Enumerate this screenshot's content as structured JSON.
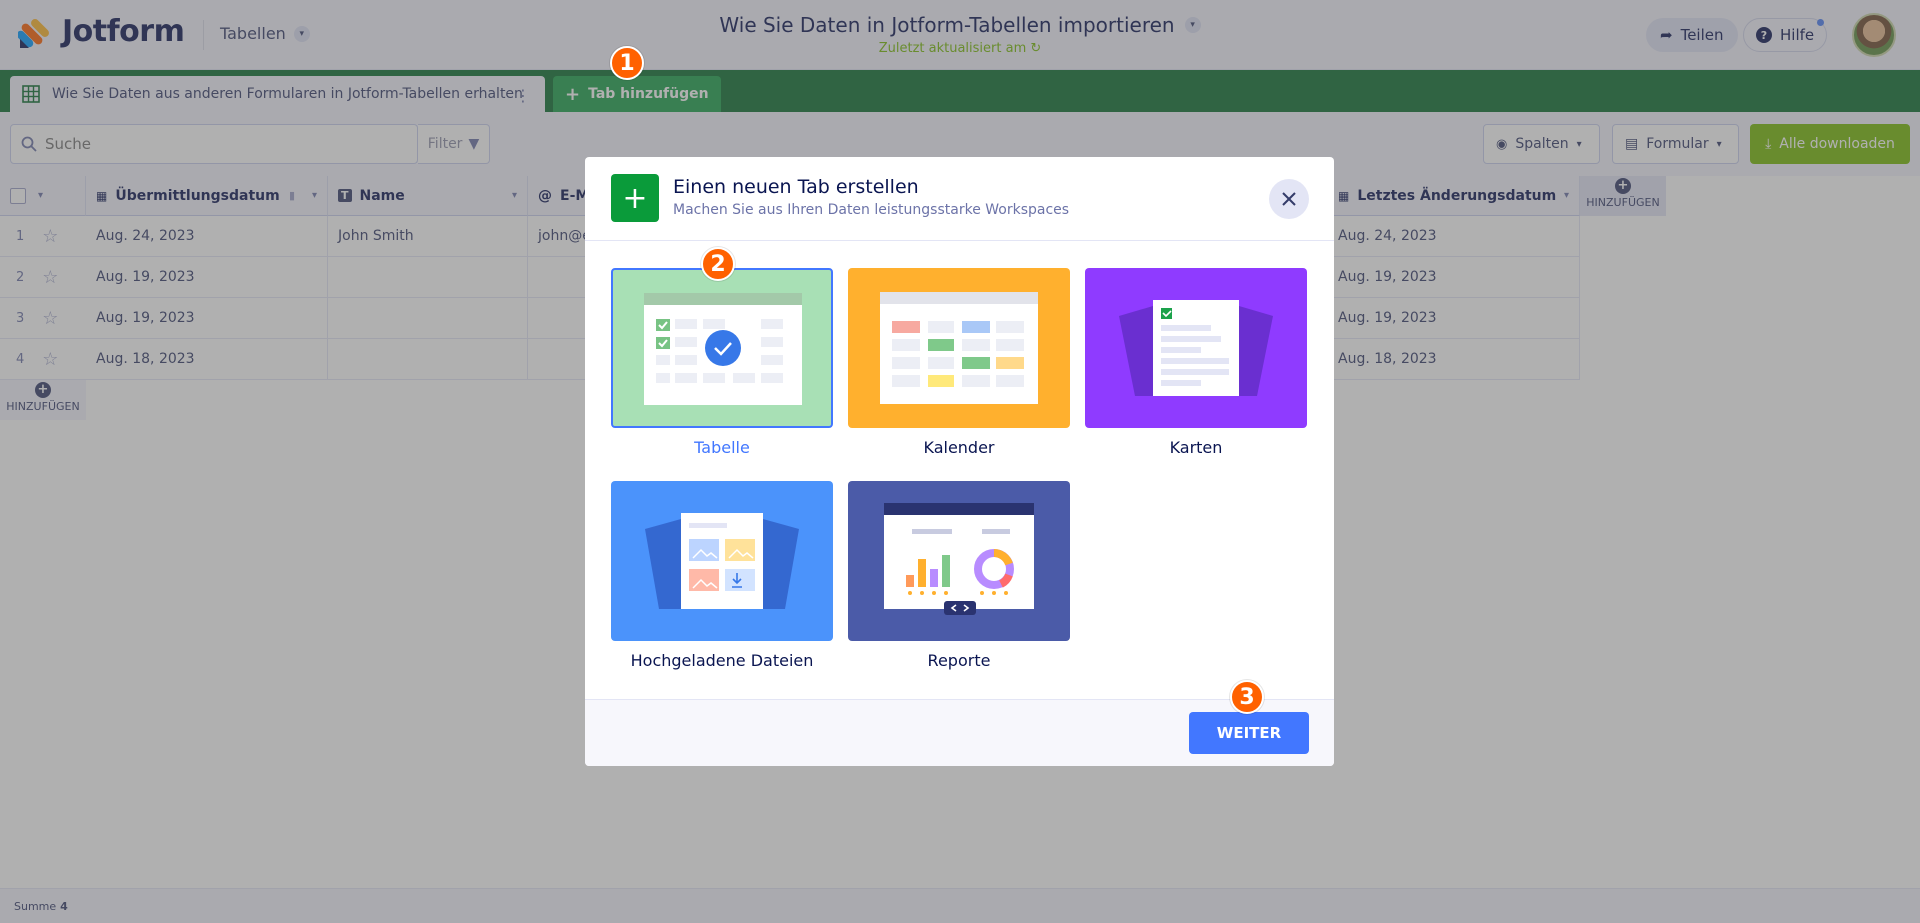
{
  "header": {
    "logo_text": "Jotform",
    "app_switch_label": "Tabellen",
    "doc_title": "Wie Sie Daten in Jotform-Tabellen importieren",
    "doc_status": "Zuletzt aktualisiert am",
    "share_label": "Teilen",
    "help_label": "Hilfe"
  },
  "tabs": {
    "active_tab_label": "Wie Sie Daten aus anderen Formularen in Jotform-Tabellen erhalten",
    "add_tab_label": "Tab hinzufügen"
  },
  "toolbar": {
    "search_placeholder": "Suche",
    "filter_label": "Filter",
    "columns_label": "Spalten",
    "form_label": "Formular",
    "download_label": "Alle downloaden"
  },
  "table": {
    "columns": [
      {
        "label": "Übermittlungsdatum",
        "icon": "calendar-icon"
      },
      {
        "label": "Name",
        "icon": "text-icon"
      },
      {
        "label": "E-M",
        "icon": "at-icon"
      },
      {
        "label": "Letztes Änderungsdatum",
        "icon": "calendar-icon"
      }
    ],
    "add_column_label": "HINZUFÜGEN",
    "add_row_label": "HINZUFÜGEN",
    "rows": [
      {
        "num": "1",
        "date": "Aug. 24, 2023",
        "name": "John Smith",
        "email": "john@e",
        "modified": "Aug. 24, 2023"
      },
      {
        "num": "2",
        "date": "Aug. 19, 2023",
        "name": "",
        "email": "",
        "modified": "Aug. 19, 2023"
      },
      {
        "num": "3",
        "date": "Aug. 19, 2023",
        "name": "",
        "email": "",
        "modified": "Aug. 19, 2023"
      },
      {
        "num": "4",
        "date": "Aug. 18, 2023",
        "name": "",
        "email": "",
        "modified": "Aug. 18, 2023"
      }
    ],
    "footer_label": "Summe",
    "footer_value": "4"
  },
  "modal": {
    "title": "Einen neuen Tab erstellen",
    "subtitle": "Machen Sie aus Ihren Daten leistungsstarke Workspaces",
    "options": [
      {
        "label": "Tabelle",
        "selected": true,
        "color": "#a8e0b5"
      },
      {
        "label": "Kalender",
        "selected": false,
        "color": "#ffb02e"
      },
      {
        "label": "Karten",
        "selected": false,
        "color": "#8f3bff"
      },
      {
        "label": "Hochgeladene Dateien",
        "selected": false,
        "color": "#4b93fb"
      },
      {
        "label": "Reporte",
        "selected": false,
        "color": "#4b5ba8"
      }
    ],
    "next_label": "WEITER"
  },
  "steps": [
    "1",
    "2",
    "3"
  ],
  "colors": {
    "accent_green": "#0a6e2f",
    "add_tab_green": "#1ca24b",
    "primary_blue": "#4277ff",
    "step_orange": "#ff6100",
    "download_green": "#78bb07"
  }
}
